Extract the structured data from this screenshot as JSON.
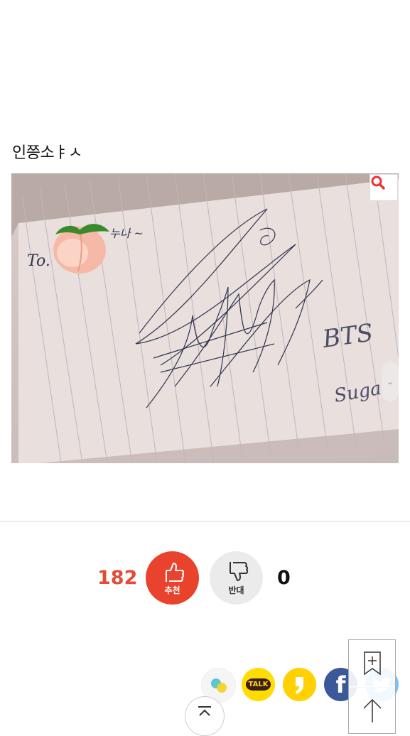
{
  "post": {
    "caption": "인쯩소ㅑㅅ",
    "image": {
      "alt_icon": "magnifier-icon",
      "handwriting": {
        "to": "To.",
        "noona": "누나 ~",
        "group": "BTS",
        "name": "Suga"
      },
      "emoji": "peach"
    }
  },
  "votes": {
    "up_count": "182",
    "up_label": "추천",
    "down_label": "반대",
    "down_count": "0",
    "up_color": "#e9432e",
    "down_color": "#ebebeb"
  },
  "share": {
    "kakaotalk_label": "TALK",
    "facebook_label": "f",
    "icons": [
      "band-icon",
      "kakaotalk-icon",
      "kakaostory-icon",
      "facebook-icon",
      "twitter-icon"
    ]
  },
  "controls": {
    "top_icon": "chevron-up-double-icon",
    "bookmark_icon": "bookmark-add-icon",
    "scroll_up_icon": "arrow-up-icon"
  }
}
